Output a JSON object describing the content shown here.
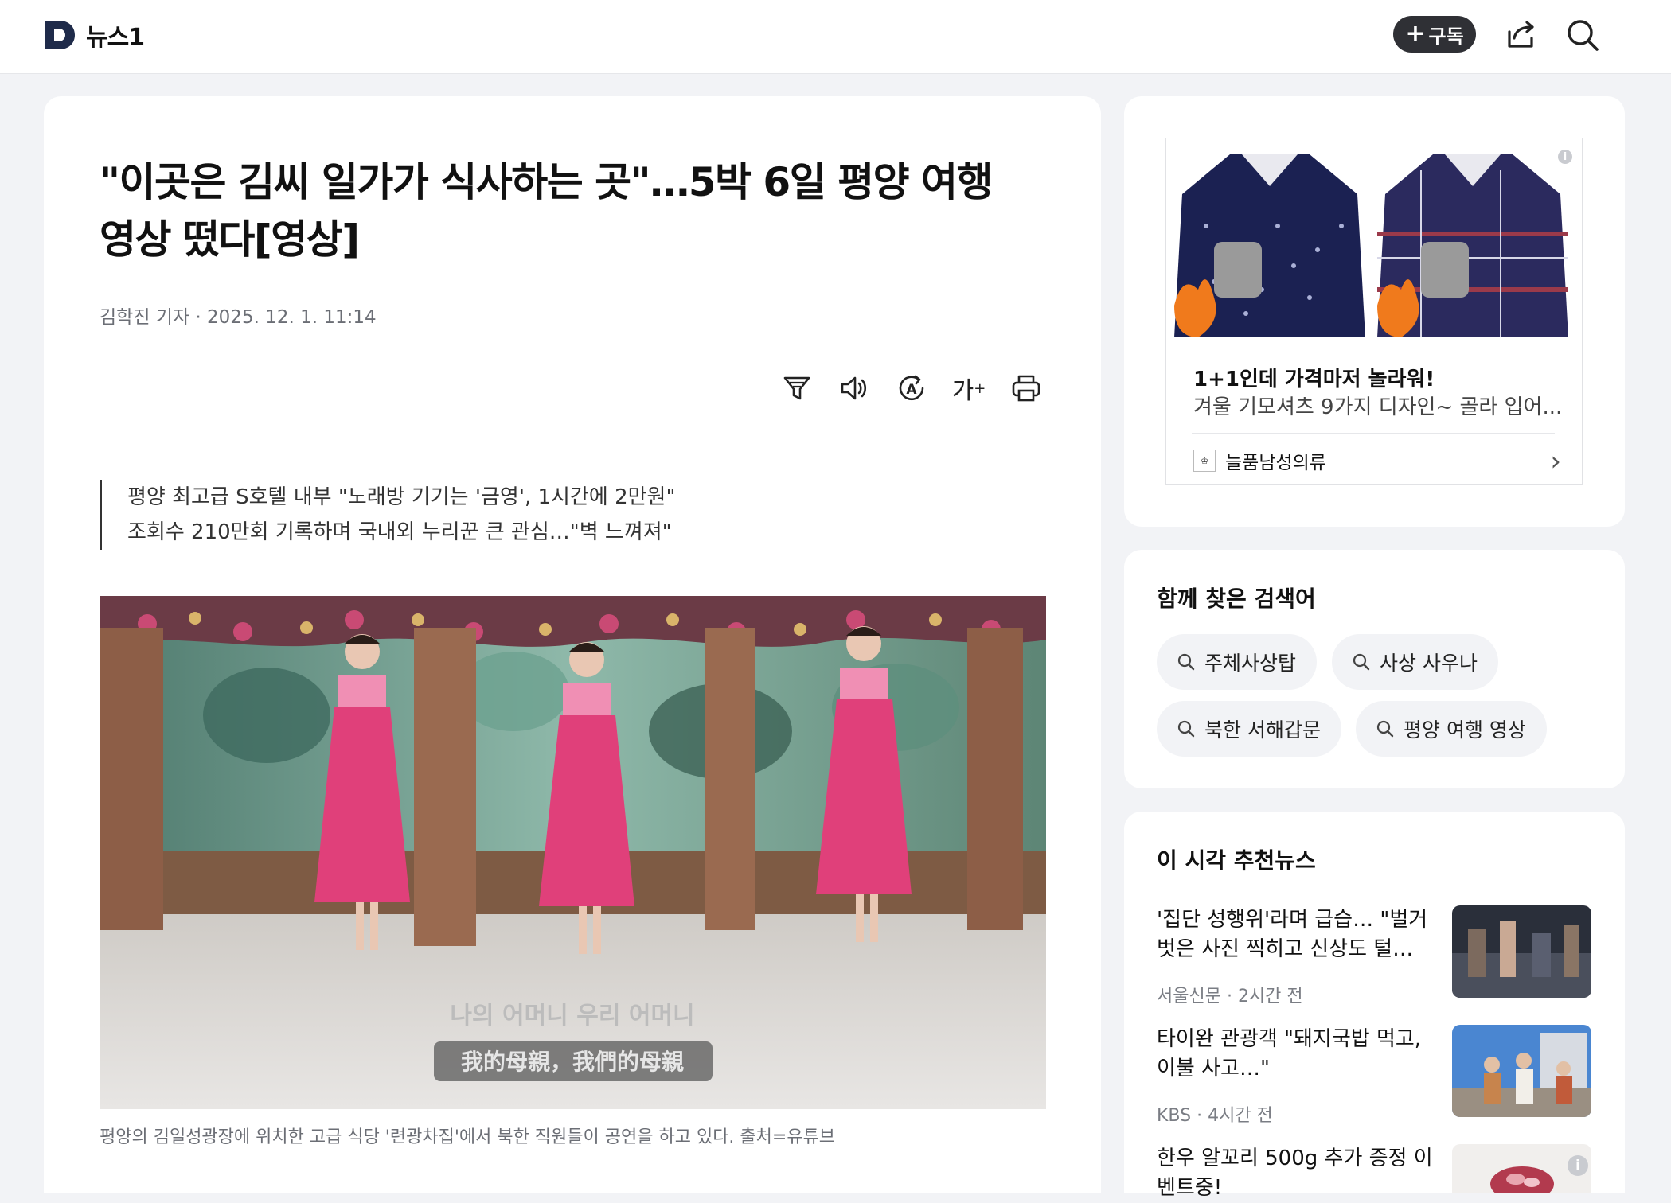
{
  "header": {
    "logo_text": "뉴스1",
    "subscribe_label": "구독",
    "share_icon": "share-icon",
    "search_icon": "search-icon"
  },
  "article": {
    "title": "\"이곳은 김씨 일가가 식사하는 곳\"…5박 6일 평양 여행 영상 떴다[영상]",
    "byline": "김학진 기자 · 2025. 12. 1. 11:14",
    "tools": {
      "font_size_label": "가",
      "icons": [
        "filter-icon",
        "speaker-icon",
        "translate-icon",
        "font-size-icon",
        "print-icon"
      ]
    },
    "summary": [
      "평양 최고급 S호텔 내부 \"노래방 기기는 '금영', 1시간에 2만원\"",
      "조회수 210만회 기록하며 국내외 누리꾼 큰 관심…\"벽 느껴져\""
    ],
    "photo_subtitle_korean": "나의 어머니 우리 어머니",
    "photo_subtitle_chinese": "我的母親，我們的母親",
    "caption": "평양의 김일성광장에 위치한 고급 식당 '련광차집'에서 북한 직원들이 공연을 하고 있다. 출처=유튜브"
  },
  "ad": {
    "headline": "1+1인데 가격마저 놀라워!",
    "description": "겨울 기모셔츠 9가지 디자인~ 골라 입어...",
    "brand": "늘품남성의류",
    "brand_logo_text": "♔",
    "chevron": "›",
    "info": "i"
  },
  "related_searches": {
    "title": "함께 찾은 검색어",
    "items": [
      "주체사상탑",
      "사상 사우나",
      "북한 서해갑문",
      "평양 여행 영상"
    ]
  },
  "recommended": {
    "title": "이 시각 추천뉴스",
    "items": [
      {
        "title": "'집단 성행위'라며 급습… \"벌거벗은 사진 찍히고 신상도 털…",
        "meta": "서울신문 · 2시간 전"
      },
      {
        "title": "타이완 관광객 \"돼지국밥 먹고, 이불 사고…\"",
        "meta": "KBS · 4시간 전"
      },
      {
        "title": "한우 알꼬리 500g 추가 증정 이벤트중!",
        "meta": ""
      }
    ]
  },
  "colors": {
    "background": "#f2f3f6",
    "dress_pink": "#e0407a",
    "shirt_navy": "#1b2152",
    "subscribe_bg": "#2f3035"
  }
}
